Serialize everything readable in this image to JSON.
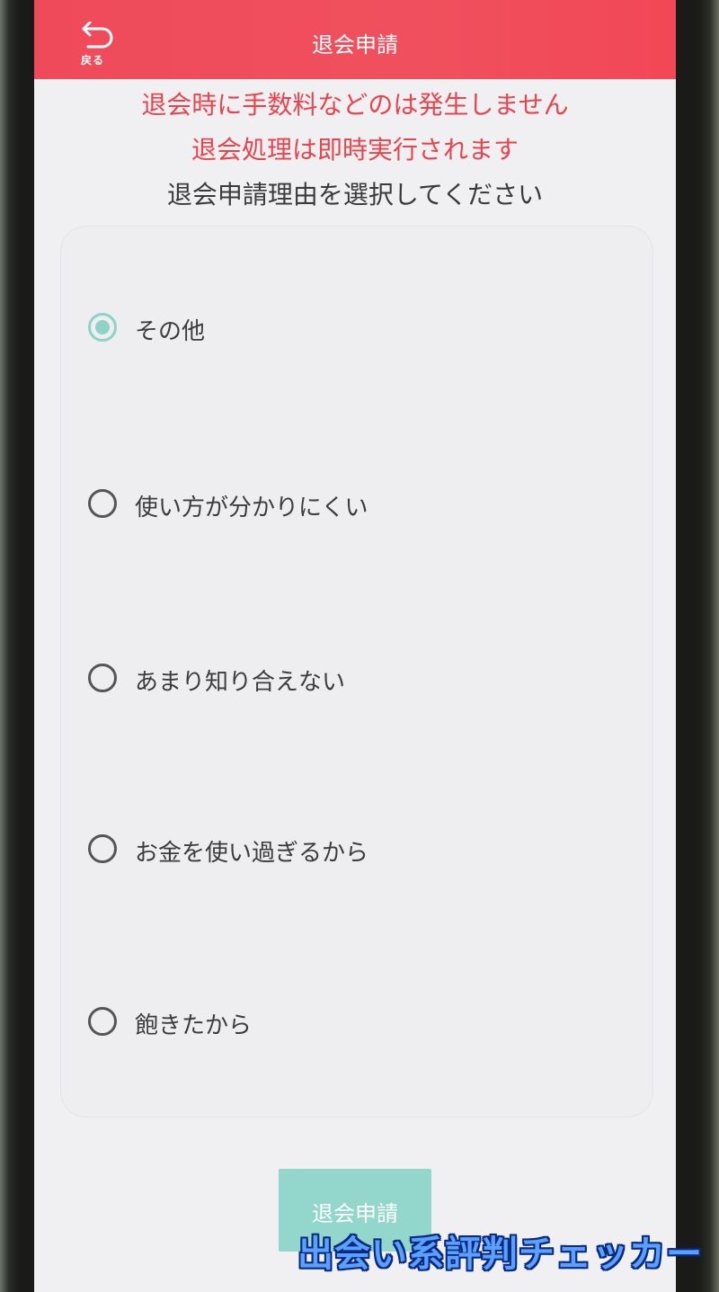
{
  "header": {
    "title": "退会申請",
    "back_label": "戻る",
    "back_icon": "undo-arrow-icon"
  },
  "notices": {
    "line1": "退会時に手数料などのは発生しません",
    "line2": "退会処理は即時実行されます",
    "prompt": "退会申請理由を選択してください"
  },
  "reasons": {
    "options": [
      {
        "label": "その他",
        "selected": true
      },
      {
        "label": "使い方が分かりにくい",
        "selected": false
      },
      {
        "label": "あまり知り合えない",
        "selected": false
      },
      {
        "label": "お金を使い過ぎるから",
        "selected": false
      },
      {
        "label": "飽きたから",
        "selected": false
      }
    ]
  },
  "submit": {
    "label": "退会申請"
  },
  "watermark": {
    "text": "出会い系評判チェッカー"
  },
  "colors": {
    "header": "#ef4a5a",
    "notice_red": "#e8444e",
    "accent_teal": "#8ed2c8"
  }
}
